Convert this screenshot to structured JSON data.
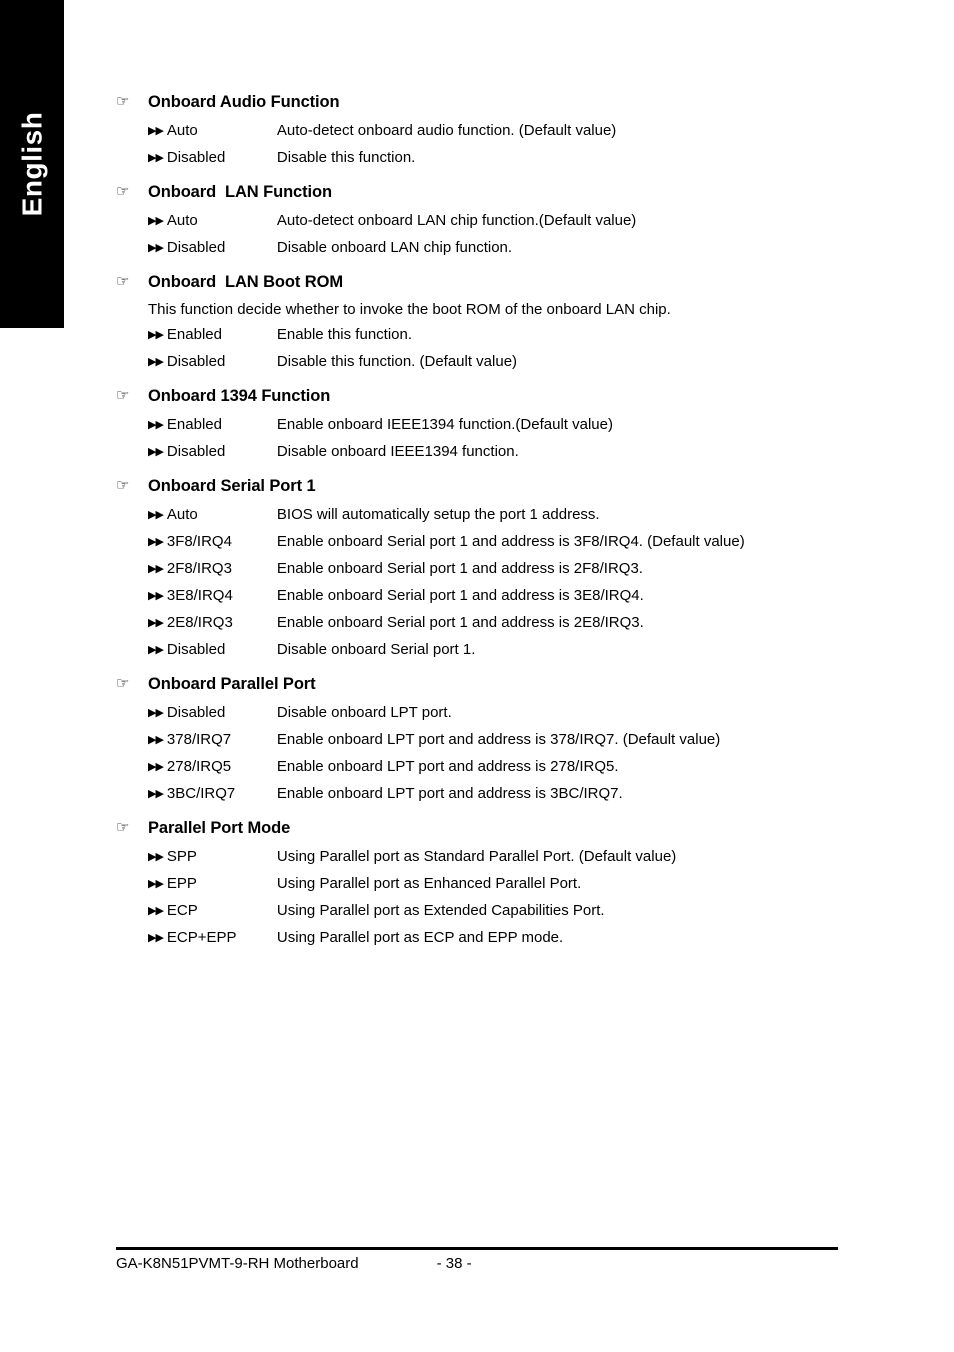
{
  "side_tab": {
    "label": "English"
  },
  "icons": {
    "hand_pointer": "☞",
    "double_arrow": "▶▶"
  },
  "sections": [
    {
      "title": "Onboard Audio Function",
      "note": "",
      "options": [
        {
          "name": "Auto",
          "desc": "Auto-detect onboard audio function. (Default value)"
        },
        {
          "name": "Disabled",
          "desc": "Disable this function."
        }
      ]
    },
    {
      "title": "Onboard  LAN Function",
      "note": "",
      "options": [
        {
          "name": "Auto",
          "desc": "Auto-detect onboard LAN chip function.(Default value)"
        },
        {
          "name": "Disabled",
          "desc": "Disable onboard LAN chip function."
        }
      ]
    },
    {
      "title": "Onboard  LAN Boot ROM",
      "note": "This function decide whether to invoke the boot ROM of the onboard LAN chip.",
      "options": [
        {
          "name": "Enabled",
          "desc": "Enable this function."
        },
        {
          "name": "Disabled",
          "desc": "Disable this function. (Default value)"
        }
      ]
    },
    {
      "title": "Onboard 1394 Function",
      "note": "",
      "options": [
        {
          "name": "Enabled",
          "desc": "Enable onboard IEEE1394 function.(Default value)"
        },
        {
          "name": "Disabled",
          "desc": "Disable onboard IEEE1394 function."
        }
      ]
    },
    {
      "title": "Onboard Serial Port 1",
      "note": "",
      "options": [
        {
          "name": "Auto",
          "desc": "BIOS will automatically setup the port 1 address."
        },
        {
          "name": "3F8/IRQ4",
          "desc": "Enable onboard Serial port 1 and address is 3F8/IRQ4. (Default value)"
        },
        {
          "name": "2F8/IRQ3",
          "desc": "Enable onboard Serial port 1 and address is 2F8/IRQ3."
        },
        {
          "name": "3E8/IRQ4",
          "desc": "Enable onboard Serial port 1 and address is 3E8/IRQ4."
        },
        {
          "name": "2E8/IRQ3",
          "desc": "Enable onboard Serial port 1 and address is 2E8/IRQ3."
        },
        {
          "name": "Disabled",
          "desc": "Disable onboard Serial port 1."
        }
      ]
    },
    {
      "title": "Onboard Parallel Port",
      "note": "",
      "options": [
        {
          "name": "Disabled",
          "desc": "Disable onboard LPT port."
        },
        {
          "name": "378/IRQ7",
          "desc": "Enable onboard LPT port and address is 378/IRQ7. (Default value)"
        },
        {
          "name": "278/IRQ5",
          "desc": "Enable onboard LPT port and address is 278/IRQ5."
        },
        {
          "name": "3BC/IRQ7",
          "desc": "Enable onboard LPT port and address is 3BC/IRQ7."
        }
      ]
    },
    {
      "title": "Parallel Port Mode",
      "note": "",
      "options": [
        {
          "name": "SPP",
          "desc": "Using Parallel port as Standard Parallel Port. (Default value)"
        },
        {
          "name": "EPP",
          "desc": "Using Parallel port as Enhanced Parallel Port."
        },
        {
          "name": "ECP",
          "desc": "Using Parallel port as Extended Capabilities Port."
        },
        {
          "name": "ECP+EPP",
          "desc": "Using Parallel port as ECP and EPP mode."
        }
      ]
    }
  ],
  "footer": {
    "board": "GA-K8N51PVMT-9-RH Motherboard",
    "page_number": "- 38 -"
  }
}
